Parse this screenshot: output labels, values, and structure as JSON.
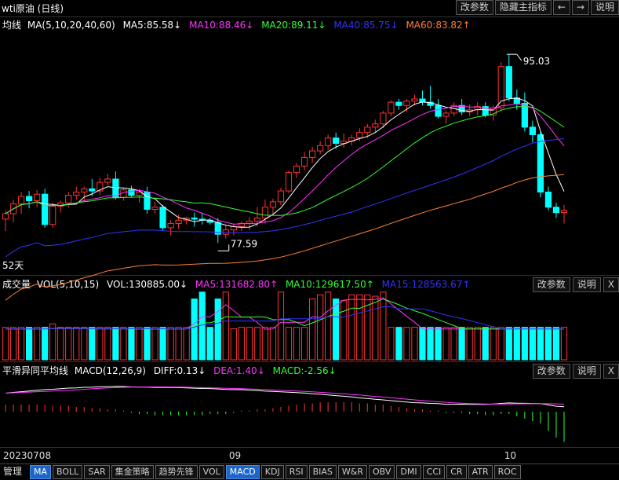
{
  "header": {
    "title": "wti原油 (日线)",
    "buttons": [
      "改参数",
      "隐藏主指标",
      "←",
      "→",
      "说明"
    ]
  },
  "main_legend": {
    "name": "均线",
    "params": "MA(5,10,20,40,60)",
    "items": [
      {
        "label": "MA5:85.58↓",
        "color": "#ffffff"
      },
      {
        "label": "MA10:88.46↓",
        "color": "#ff33ff"
      },
      {
        "label": "MA20:89.11↓",
        "color": "#33ff33"
      },
      {
        "label": "MA40:85.75↓",
        "color": "#3333ff"
      },
      {
        "label": "MA60:83.82↑",
        "color": "#ff8033"
      }
    ]
  },
  "vol_legend": {
    "name": "成交量",
    "params": "VOL(5,10,15)",
    "items": [
      {
        "label": "VOL:130885.00↓",
        "color": "#ffffff"
      },
      {
        "label": "MA5:131682.80↑",
        "color": "#ff33ff"
      },
      {
        "label": "MA10:129617.50↑",
        "color": "#33ff33"
      },
      {
        "label": "MA15:128563.67↑",
        "color": "#3333ff"
      }
    ],
    "buttons": [
      "改参数",
      "说明",
      "X"
    ]
  },
  "macd_legend": {
    "name": "平滑异同平均线",
    "params": "MACD(12,26,9)",
    "items": [
      {
        "label": "DIFF:0.13↓",
        "color": "#ffffff"
      },
      {
        "label": "DEA:1.40↓",
        "color": "#ff33ff"
      },
      {
        "label": "MACD:-2.56↓",
        "color": "#33ff33"
      }
    ],
    "buttons": [
      "改参数",
      "说明",
      "X"
    ]
  },
  "annotations": {
    "high": "95.03",
    "low": "77.59",
    "period": "52天"
  },
  "x_axis": {
    "labels": [
      "20230708",
      "09",
      "10"
    ]
  },
  "bottom_tabs": [
    "管理",
    "MA",
    "BOLL",
    "SAR",
    "集金策略",
    "趋势先锋",
    "VOL",
    "MACD",
    "KDJ",
    "RSI",
    "BIAS",
    "W&R",
    "OBV",
    "DMI",
    "CCI",
    "CR",
    "ATR",
    "ROC"
  ],
  "colors": {
    "up": "#ff3232",
    "down": "#00ffff",
    "ma5": "#ffffff",
    "ma10": "#ff33ff",
    "ma20": "#33ff33",
    "ma40": "#3333ff",
    "ma60": "#ff8033"
  },
  "chart_data": {
    "type": "candlestick",
    "price_range": [
      75,
      97
    ],
    "candles": [
      {
        "o": 79.8,
        "h": 80.6,
        "l": 78.7,
        "c": 80.3
      },
      {
        "o": 80.3,
        "h": 81.6,
        "l": 79.5,
        "c": 81.2
      },
      {
        "o": 81.2,
        "h": 82.3,
        "l": 80.3,
        "c": 81.9
      },
      {
        "o": 81.9,
        "h": 82.4,
        "l": 80.8,
        "c": 81.5
      },
      {
        "o": 81.5,
        "h": 82.5,
        "l": 80.9,
        "c": 82.1
      },
      {
        "o": 82.1,
        "h": 82.6,
        "l": 79.0,
        "c": 79.3
      },
      {
        "o": 79.3,
        "h": 81.3,
        "l": 79.0,
        "c": 81.0
      },
      {
        "o": 81.0,
        "h": 81.5,
        "l": 80.4,
        "c": 81.3
      },
      {
        "o": 81.3,
        "h": 82.3,
        "l": 80.9,
        "c": 82.0
      },
      {
        "o": 82.0,
        "h": 82.8,
        "l": 81.6,
        "c": 82.3
      },
      {
        "o": 82.3,
        "h": 82.8,
        "l": 81.4,
        "c": 82.6
      },
      {
        "o": 82.6,
        "h": 83.5,
        "l": 81.9,
        "c": 82.4
      },
      {
        "o": 82.4,
        "h": 83.6,
        "l": 82.0,
        "c": 83.2
      },
      {
        "o": 83.2,
        "h": 84.0,
        "l": 82.9,
        "c": 83.5
      },
      {
        "o": 83.5,
        "h": 84.2,
        "l": 81.6,
        "c": 81.8
      },
      {
        "o": 81.8,
        "h": 82.7,
        "l": 81.5,
        "c": 82.5
      },
      {
        "o": 82.5,
        "h": 82.9,
        "l": 81.8,
        "c": 82.0
      },
      {
        "o": 82.0,
        "h": 82.6,
        "l": 81.3,
        "c": 82.3
      },
      {
        "o": 82.3,
        "h": 82.8,
        "l": 80.3,
        "c": 80.7
      },
      {
        "o": 80.7,
        "h": 81.4,
        "l": 80.3,
        "c": 80.9
      },
      {
        "o": 80.9,
        "h": 81.1,
        "l": 78.7,
        "c": 79.0
      },
      {
        "o": 79.0,
        "h": 79.7,
        "l": 78.3,
        "c": 79.4
      },
      {
        "o": 79.4,
        "h": 80.2,
        "l": 78.9,
        "c": 79.7
      },
      {
        "o": 79.7,
        "h": 80.0,
        "l": 79.3,
        "c": 79.9
      },
      {
        "o": 79.9,
        "h": 80.4,
        "l": 79.1,
        "c": 79.8
      },
      {
        "o": 79.8,
        "h": 80.4,
        "l": 79.3,
        "c": 79.7
      },
      {
        "o": 79.7,
        "h": 79.9,
        "l": 79.3,
        "c": 79.5
      },
      {
        "o": 79.5,
        "h": 79.9,
        "l": 77.6,
        "c": 78.4
      },
      {
        "o": 78.4,
        "h": 79.2,
        "l": 78.0,
        "c": 78.8
      },
      {
        "o": 78.8,
        "h": 79.4,
        "l": 78.3,
        "c": 79.1
      },
      {
        "o": 79.1,
        "h": 79.6,
        "l": 78.7,
        "c": 79.4
      },
      {
        "o": 79.4,
        "h": 80.0,
        "l": 78.8,
        "c": 79.6
      },
      {
        "o": 79.6,
        "h": 80.9,
        "l": 79.1,
        "c": 79.9
      },
      {
        "o": 79.9,
        "h": 81.6,
        "l": 79.4,
        "c": 80.9
      },
      {
        "o": 80.9,
        "h": 81.7,
        "l": 80.3,
        "c": 81.4
      },
      {
        "o": 81.4,
        "h": 82.7,
        "l": 81.1,
        "c": 82.4
      },
      {
        "o": 82.4,
        "h": 84.3,
        "l": 82.2,
        "c": 84.1
      },
      {
        "o": 84.1,
        "h": 85.0,
        "l": 83.6,
        "c": 84.7
      },
      {
        "o": 84.7,
        "h": 86.0,
        "l": 84.3,
        "c": 85.5
      },
      {
        "o": 85.5,
        "h": 86.5,
        "l": 85.0,
        "c": 86.1
      },
      {
        "o": 86.1,
        "h": 87.0,
        "l": 85.8,
        "c": 86.6
      },
      {
        "o": 86.6,
        "h": 87.6,
        "l": 86.2,
        "c": 87.3
      },
      {
        "o": 87.3,
        "h": 87.8,
        "l": 86.3,
        "c": 86.8
      },
      {
        "o": 86.8,
        "h": 87.7,
        "l": 86.4,
        "c": 87.0
      },
      {
        "o": 87.0,
        "h": 87.6,
        "l": 86.6,
        "c": 87.3
      },
      {
        "o": 87.3,
        "h": 88.2,
        "l": 87.0,
        "c": 87.8
      },
      {
        "o": 87.8,
        "h": 88.6,
        "l": 87.3,
        "c": 88.3
      },
      {
        "o": 88.3,
        "h": 89.0,
        "l": 87.8,
        "c": 88.6
      },
      {
        "o": 88.6,
        "h": 89.8,
        "l": 88.2,
        "c": 89.6
      },
      {
        "o": 89.6,
        "h": 90.8,
        "l": 89.3,
        "c": 90.6
      },
      {
        "o": 90.6,
        "h": 90.9,
        "l": 89.9,
        "c": 90.3
      },
      {
        "o": 90.3,
        "h": 90.9,
        "l": 89.7,
        "c": 90.7
      },
      {
        "o": 90.7,
        "h": 91.3,
        "l": 90.3,
        "c": 90.9
      },
      {
        "o": 90.9,
        "h": 91.7,
        "l": 90.3,
        "c": 90.6
      },
      {
        "o": 90.6,
        "h": 92.1,
        "l": 90.0,
        "c": 90.3
      },
      {
        "o": 90.3,
        "h": 90.9,
        "l": 89.1,
        "c": 89.3
      },
      {
        "o": 89.3,
        "h": 89.8,
        "l": 88.6,
        "c": 89.6
      },
      {
        "o": 89.6,
        "h": 90.6,
        "l": 89.3,
        "c": 90.3
      },
      {
        "o": 90.3,
        "h": 90.9,
        "l": 89.4,
        "c": 89.7
      },
      {
        "o": 89.7,
        "h": 90.4,
        "l": 89.3,
        "c": 89.9
      },
      {
        "o": 89.9,
        "h": 90.6,
        "l": 89.4,
        "c": 90.2
      },
      {
        "o": 90.2,
        "h": 90.6,
        "l": 89.2,
        "c": 89.4
      },
      {
        "o": 89.4,
        "h": 90.3,
        "l": 88.9,
        "c": 90.1
      },
      {
        "o": 90.1,
        "h": 94.3,
        "l": 89.8,
        "c": 93.9
      },
      {
        "o": 93.9,
        "h": 95.03,
        "l": 90.7,
        "c": 91.0
      },
      {
        "o": 91.0,
        "h": 91.8,
        "l": 89.9,
        "c": 90.5
      },
      {
        "o": 90.5,
        "h": 91.5,
        "l": 87.9,
        "c": 88.3
      },
      {
        "o": 88.3,
        "h": 88.9,
        "l": 86.9,
        "c": 87.6
      },
      {
        "o": 87.6,
        "h": 87.9,
        "l": 81.8,
        "c": 82.3
      },
      {
        "o": 82.3,
        "h": 82.8,
        "l": 80.6,
        "c": 80.9
      },
      {
        "o": 80.9,
        "h": 81.3,
        "l": 79.9,
        "c": 80.4
      },
      {
        "o": 80.4,
        "h": 81.1,
        "l": 79.4,
        "c": 80.6
      }
    ],
    "volumes": [
      45,
      45,
      45,
      45,
      45,
      45,
      45,
      45,
      45,
      45,
      45,
      45,
      45,
      45,
      45,
      45,
      45,
      45,
      45,
      45,
      45,
      45,
      45,
      45,
      45,
      45,
      45,
      45,
      45,
      45,
      45,
      45,
      45,
      45,
      45,
      45,
      45,
      45,
      45,
      45,
      45,
      45,
      45,
      45,
      45,
      45,
      45,
      45,
      45,
      45,
      45,
      45,
      45,
      45,
      45,
      45,
      45,
      45,
      45,
      45,
      45,
      45,
      45,
      45,
      45,
      45,
      45,
      45,
      45,
      45,
      45,
      45
    ],
    "volume_heights": [
      0.47,
      0.47,
      0.47,
      0.47,
      0.47,
      0.47,
      0.52,
      0.47,
      0.47,
      0.47,
      0.47,
      0.47,
      0.47,
      0.47,
      0.47,
      0.47,
      0.47,
      0.47,
      0.47,
      0.47,
      0.47,
      0.47,
      0.47,
      0.47,
      0.88,
      0.98,
      0.47,
      0.88,
      0.98,
      0.45,
      0.47,
      0.47,
      0.47,
      0.47,
      0.47,
      0.98,
      0.47,
      0.47,
      0.47,
      0.88,
      0.94,
      0.98,
      0.88,
      0.86,
      0.94,
      0.94,
      0.94,
      0.92,
      0.98,
      0.47,
      0.47,
      0.47,
      0.47,
      0.47,
      0.47,
      0.47,
      0.47,
      0.47,
      0.47,
      0.47,
      0.47,
      0.47,
      0.47,
      0.47,
      0.47,
      0.47,
      0.47,
      0.47,
      0.47,
      0.47,
      0.47,
      0.47
    ],
    "macd_hist": [
      0.6,
      0.6,
      0.6,
      0.6,
      0.6,
      0.6,
      0.5,
      0.5,
      0.5,
      0.4,
      0.4,
      0.3,
      0.3,
      0.2,
      0.2,
      0.1,
      -0.1,
      -0.2,
      -0.2,
      -0.3,
      -0.3,
      -0.3,
      -0.3,
      -0.3,
      -0.3,
      -0.3,
      -0.2,
      -0.2,
      -0.2,
      -0.1,
      0.1,
      0.1,
      0.2,
      0.2,
      0.3,
      0.4,
      0.5,
      0.6,
      0.7,
      0.7,
      0.8,
      0.8,
      0.8,
      0.8,
      0.8,
      0.7,
      0.7,
      0.6,
      0.6,
      0.5,
      0.4,
      0.3,
      0.2,
      0.2,
      0.1,
      0.1,
      -0.1,
      -0.1,
      -0.1,
      -0.2,
      -0.2,
      -0.3,
      -0.3,
      -0.2,
      -0.2,
      -0.4,
      -0.6,
      -0.8,
      -1.0,
      -1.6,
      -2.2,
      -2.56
    ],
    "x_labels": [
      "20230708",
      "09",
      "10"
    ]
  }
}
